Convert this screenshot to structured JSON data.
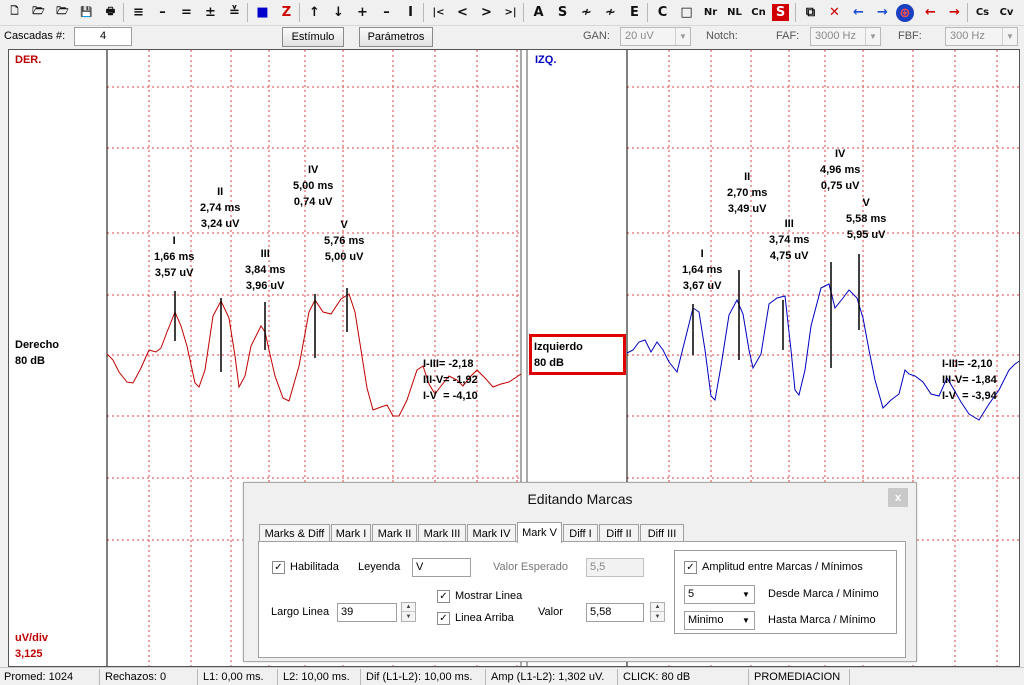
{
  "toolbar": {
    "icons": [
      "new-file-icon",
      "open-folder-icon",
      "open-folder-icon",
      "save-icon",
      "print-icon",
      "lines-icon",
      "line-h-icon",
      "lines-2-icon",
      "lines-arrows-icon",
      "line-step-icon",
      "color-blocks-icon",
      "z-icon",
      "arrow-up-icon",
      "arrow-down-icon",
      "plus-icon",
      "minus-icon",
      "i-cursor-icon",
      "first-icon",
      "prev-icon",
      "next-icon",
      "last-icon",
      "a-letter-icon",
      "s-letter-icon",
      "wave-icon",
      "wave-double-icon",
      "e-letter-icon",
      "c-letter-icon",
      "square-icon",
      "nr-icon",
      "nl-icon",
      "cn-icon",
      "red-s-icon",
      "copy-icon",
      "delete-icon",
      "arrow-left-blue-icon",
      "arrow-right-blue-icon",
      "target-icon",
      "arrow-left-red-icon",
      "arrow-right-red-icon",
      "cs-icon",
      "cv-icon"
    ],
    "glyphs": [
      "🗋",
      "🗁",
      "🗁",
      "💾",
      "🖶",
      "≡",
      "–",
      "=",
      "±",
      "≚",
      "■",
      "Z",
      "↑",
      "↓",
      "+",
      "–",
      "I",
      "|<",
      "<",
      ">",
      ">|",
      "A",
      "S",
      "≁",
      "≁",
      "E",
      "C",
      "□",
      "Nr",
      "NL",
      "Cn",
      "S",
      "⧉",
      "✕",
      "←",
      "→",
      "⊕",
      "←",
      "→",
      "Cs",
      "Cv"
    ]
  },
  "params": {
    "cascadas_label": "Cascadas #:",
    "cascadas_value": "4",
    "estimulo_label": "Estímulo",
    "parametros_label": "Parámetros",
    "gan_label": "GAN:",
    "gan_value": "20 uV",
    "notch_label": "Notch:",
    "faf_label": "FAF:",
    "faf_value": "3000 Hz",
    "fbf_label": "FBF:",
    "fbf_value": "300 Hz"
  },
  "plot": {
    "right_channel": {
      "tag": "DER.",
      "label": [
        "Derecho",
        "80 dB"
      ],
      "peaks": [
        {
          "name": "I",
          "latency": "1,66 ms",
          "amplitude": "3,57 uV"
        },
        {
          "name": "II",
          "latency": "2,74 ms",
          "amplitude": "3,24 uV"
        },
        {
          "name": "III",
          "latency": "3,84 ms",
          "amplitude": "3,96 uV"
        },
        {
          "name": "IV",
          "latency": "5,00 ms",
          "amplitude": "0,74 uV"
        },
        {
          "name": "V",
          "latency": "5,76 ms",
          "amplitude": "5,00 uV"
        }
      ],
      "diffs": [
        "I-III= -2,18",
        "III-V= -1,92",
        "I-V  = -4,10"
      ],
      "color": "#c00000"
    },
    "left_channel": {
      "tag": "IZQ.",
      "label": [
        "Izquierdo",
        "80 dB"
      ],
      "peaks": [
        {
          "name": "I",
          "latency": "1,64 ms",
          "amplitude": "3,67 uV"
        },
        {
          "name": "II",
          "latency": "2,70 ms",
          "amplitude": "3,49 uV"
        },
        {
          "name": "III",
          "latency": "3,74 ms",
          "amplitude": "4,75 uV"
        },
        {
          "name": "IV",
          "latency": "4,96 ms",
          "amplitude": "0,75 uV"
        },
        {
          "name": "V",
          "latency": "5,58 ms",
          "amplitude": "5,95 uV"
        }
      ],
      "diffs": [
        "I-III= -2,10",
        "III-V= -1,84",
        "I-V  = -3,94"
      ],
      "color": "#0000c0"
    },
    "scale_label": "uV/div",
    "scale_value": "3,125"
  },
  "dialog": {
    "title": "Editando Marcas",
    "close": "x",
    "tabs": [
      "Marks & Diff",
      "Mark I",
      "Mark II",
      "Mark III",
      "Mark IV",
      "Mark V",
      "Diff I",
      "Diff II",
      "Diff III"
    ],
    "active_tab": "Mark V",
    "habilitada_label": "Habilitada",
    "leyenda_label": "Leyenda",
    "leyenda_value": "V",
    "valor_esperado_label": "Valor Esperado",
    "valor_esperado_value": "5,5",
    "mostrar_linea_label": "Mostrar Linea",
    "linea_arriba_label": "Linea Arriba",
    "largo_linea_label": "Largo Linea",
    "largo_linea_value": "39",
    "valor_label": "Valor",
    "valor_value": "5,58",
    "amplitud_label": "Amplitud entre Marcas / Mínimos",
    "desde_value": "5",
    "desde_label": "Desde Marca / Mínimo",
    "hasta_value": "Minimo",
    "hasta_label": "Hasta Marca / Mínimo",
    "check": "✓"
  },
  "status": {
    "promed": "Promed:  1024",
    "rechazos": "Rechazos: 0",
    "l1": "L1: 0,00  ms.",
    "l2": "L2: 10,00  ms.",
    "dif": "Dif (L1-L2): 10,00  ms.",
    "amp": "Amp (L1-L2):  1,302 uV.",
    "click": "CLICK:  80 dB",
    "mode": "PROMEDIACION"
  }
}
